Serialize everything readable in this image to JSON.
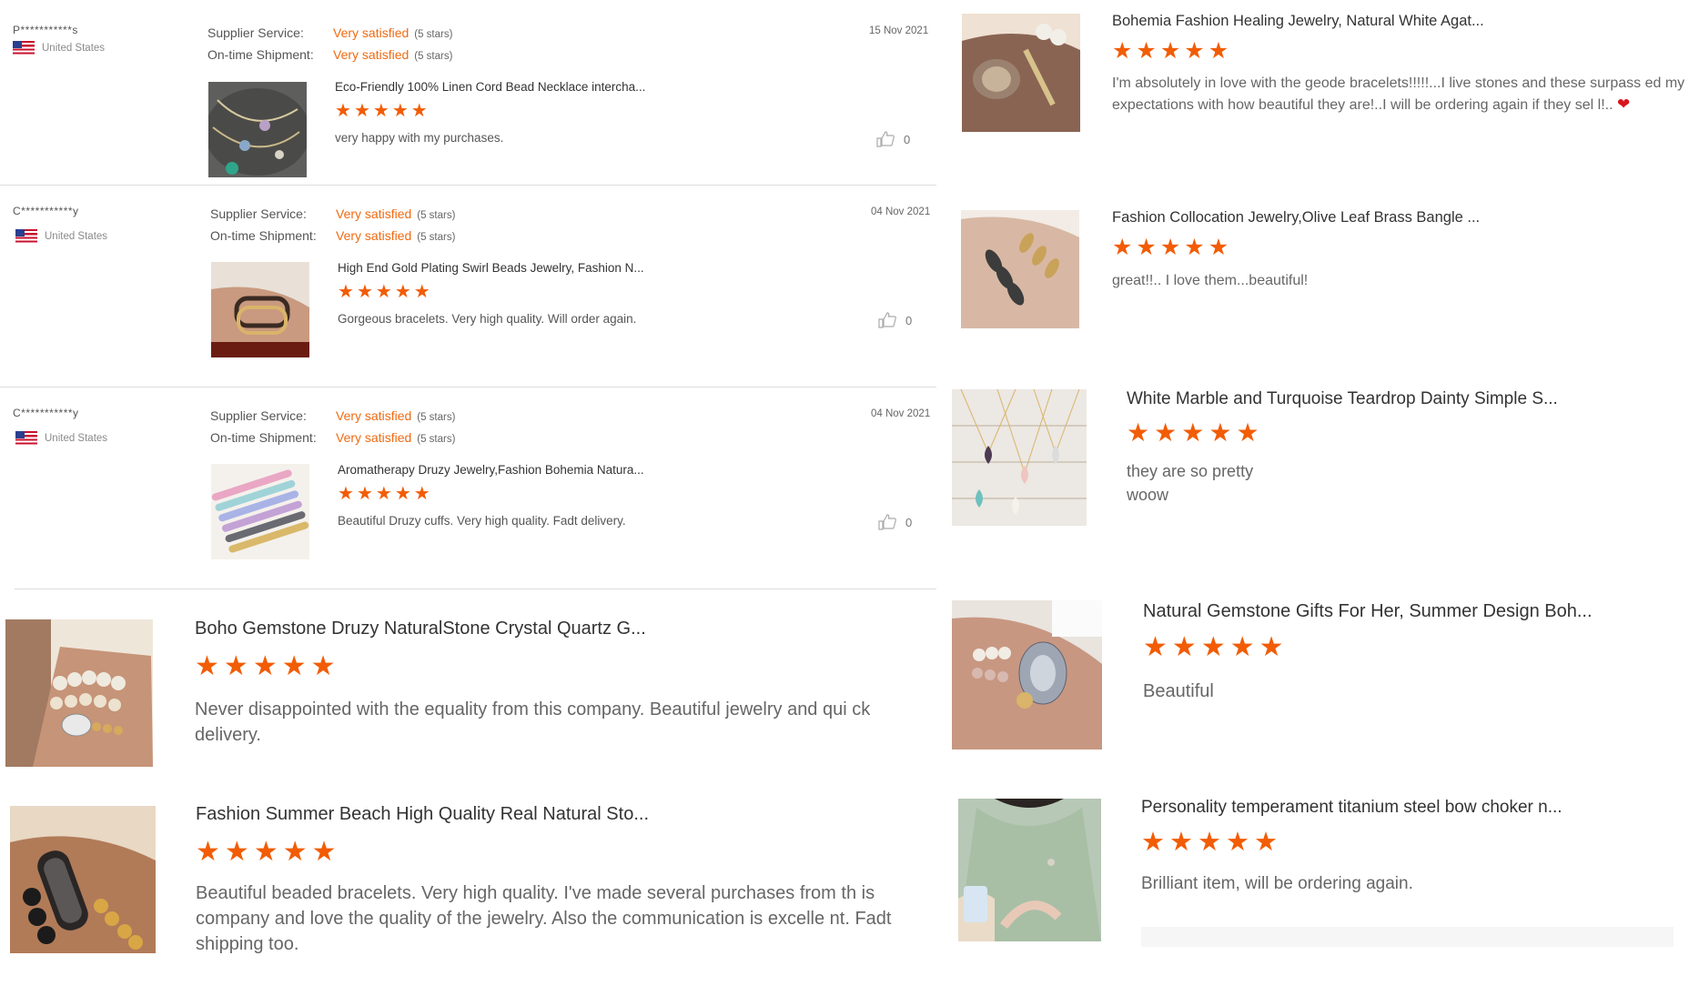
{
  "detailed_reviews": [
    {
      "buyer": "P***********s",
      "country": "United States",
      "supplier_service_label": "Supplier Service:",
      "supplier_service_value": "Very satisfied",
      "supplier_service_stars": "(5 stars)",
      "shipment_label": "On-time Shipment:",
      "shipment_value": "Very satisfied",
      "shipment_stars": "(5 stars)",
      "date": "15 Nov 2021",
      "product_title": "Eco-Friendly 100% Linen Cord Bead Necklace intercha...",
      "rating": 5,
      "text": "very happy with my purchases.",
      "likes": "0"
    },
    {
      "buyer": "C***********y",
      "country": "United States",
      "supplier_service_label": "Supplier Service:",
      "supplier_service_value": "Very satisfied",
      "supplier_service_stars": "(5 stars)",
      "shipment_label": "On-time Shipment:",
      "shipment_value": "Very satisfied",
      "shipment_stars": "(5 stars)",
      "date": "04 Nov 2021",
      "product_title": "High End Gold Plating Swirl Beads Jewelry, Fashion N...",
      "rating": 5,
      "text": "Gorgeous bracelets. Very high quality. Will order again.",
      "likes": "0"
    },
    {
      "buyer": "C***********y",
      "country": "United States",
      "supplier_service_label": "Supplier Service:",
      "supplier_service_value": "Very satisfied",
      "supplier_service_stars": "(5 stars)",
      "shipment_label": "On-time Shipment:",
      "shipment_value": "Very satisfied",
      "shipment_stars": "(5 stars)",
      "date": "04 Nov 2021",
      "product_title": "Aromatherapy Druzy Jewelry,Fashion Bohemia Natura...",
      "rating": 5,
      "text": "Beautiful Druzy cuffs. Very high quality. Fadt delivery.",
      "likes": "0"
    }
  ],
  "left_cards": [
    {
      "title": "Boho Gemstone Druzy NaturalStone Crystal Quartz G...",
      "rating": 5,
      "text": "Never disappointed with the equality from this company. Beautiful jewelry and qui ck delivery."
    },
    {
      "title": "Fashion Summer Beach High Quality Real Natural Sto...",
      "rating": 5,
      "text": "Beautiful beaded bracelets. Very high quality. I've made several purchases from th is company and love the quality of the jewelry. Also the communication is excelle nt. Fadt shipping too."
    }
  ],
  "right_cards": [
    {
      "title": "Bohemia Fashion Healing Jewelry, Natural White Agat...",
      "rating": 5,
      "text": "I'm absolutely in love with the geode bracelets!!!!!...I live stones and these surpass ed my expectations with how beautiful they are!..I will be ordering again if they sel l!..",
      "heart": "❤"
    },
    {
      "title": "Fashion Collocation Jewelry,Olive Leaf Brass Bangle ...",
      "rating": 5,
      "text": "great!!.. I love them...beautiful!"
    },
    {
      "title": "White Marble and Turquoise Teardrop Dainty Simple S...",
      "rating": 5,
      "text": "they are so pretty",
      "text2": "woow"
    },
    {
      "title": "Natural Gemstone Gifts For Her, Summer Design Boh...",
      "rating": 5,
      "text": "Beautiful"
    },
    {
      "title": "Personality temperament titanium steel bow choker n...",
      "rating": 5,
      "text": "Brilliant item, will be ordering again."
    }
  ],
  "colors": {
    "accent": "#ef6a11",
    "star": "#f25c05"
  }
}
